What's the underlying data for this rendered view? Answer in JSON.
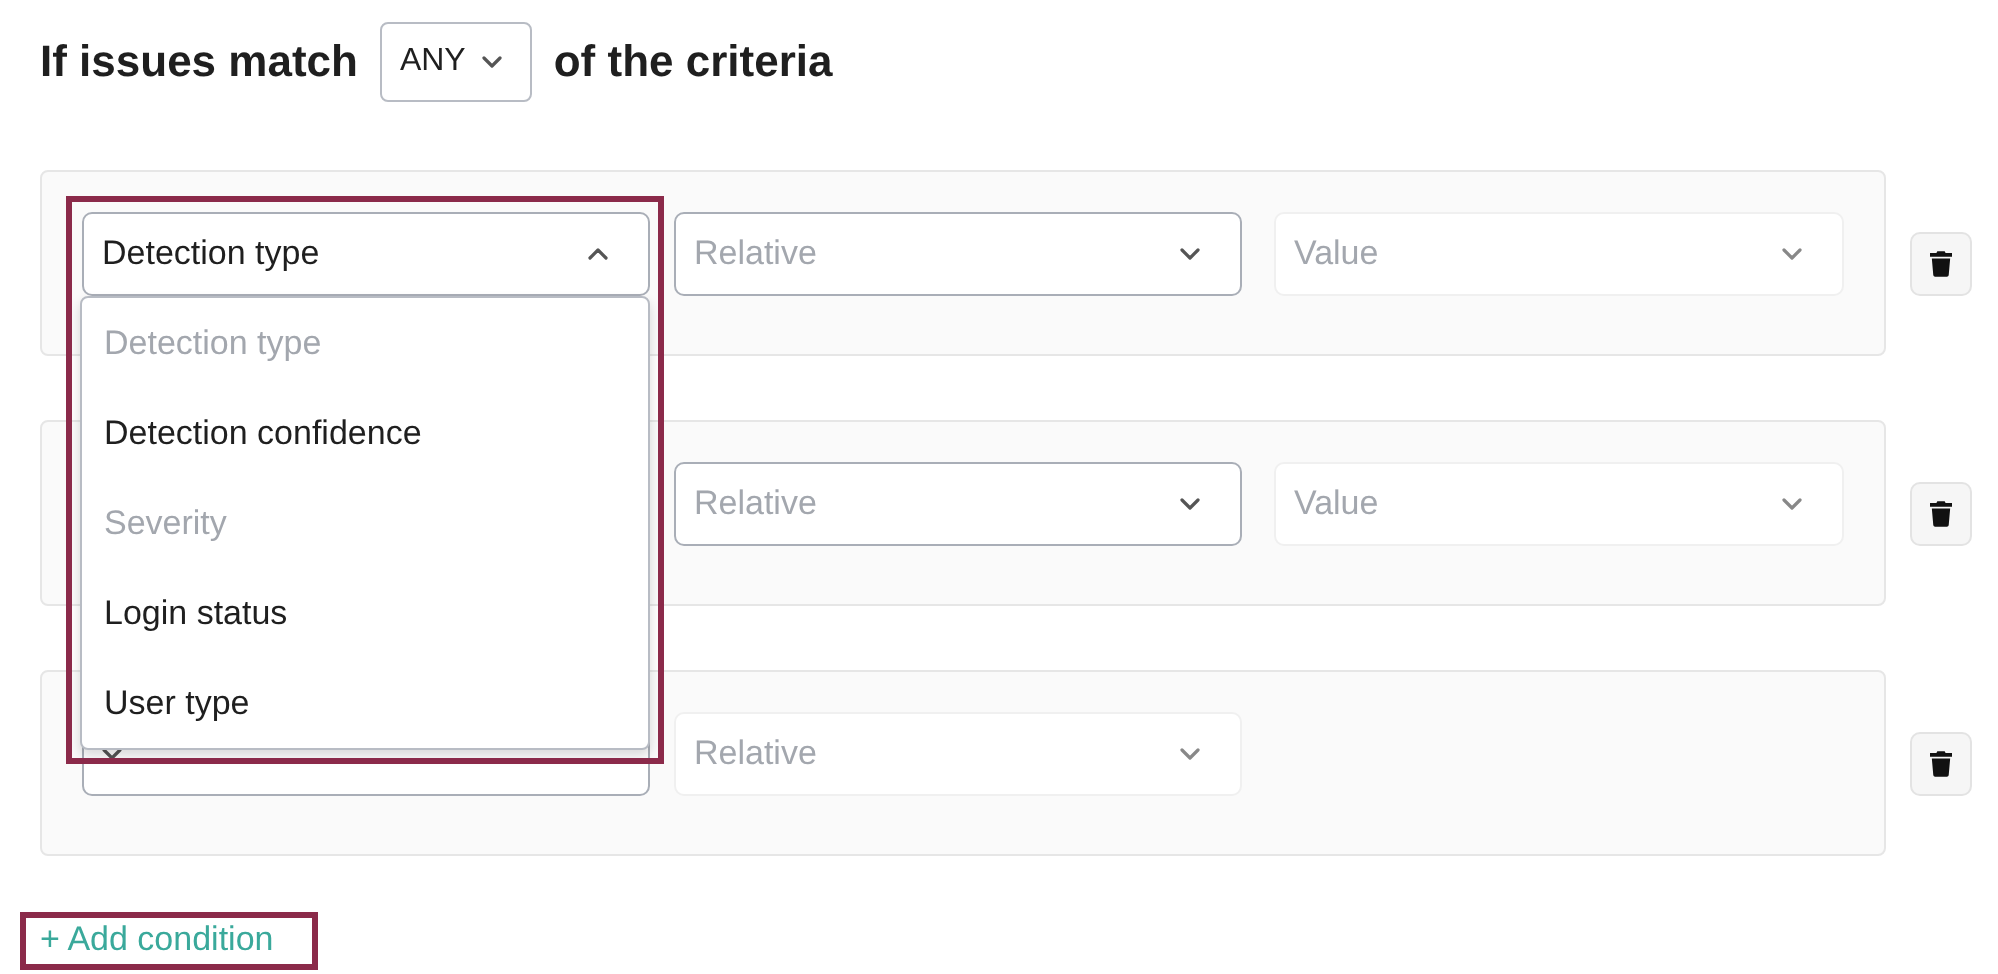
{
  "header": {
    "prefix": "If issues match",
    "match_select": {
      "value": "ANY"
    },
    "suffix": "of the criteria"
  },
  "conditions": [
    {
      "field": {
        "value": "Detection type",
        "expanded": true,
        "disabled": false
      },
      "operator": {
        "placeholder": "Relative",
        "disabled": false
      },
      "value": {
        "placeholder": "Value",
        "disabled": true
      }
    },
    {
      "operator": {
        "placeholder": "Relative",
        "disabled": false
      },
      "value": {
        "placeholder": "Value",
        "disabled": true
      }
    },
    {
      "field": {
        "expanded": false,
        "disabled": false
      },
      "operator": {
        "placeholder": "Relative",
        "disabled": true
      }
    }
  ],
  "dropdown": {
    "options": [
      {
        "label": "Detection type",
        "disabled": true
      },
      {
        "label": "Detection confidence",
        "disabled": false
      },
      {
        "label": "Severity",
        "disabled": true
      },
      {
        "label": "Login status",
        "disabled": false
      },
      {
        "label": "User type",
        "disabled": false
      }
    ]
  },
  "add_condition": {
    "label": "+ Add condition"
  }
}
